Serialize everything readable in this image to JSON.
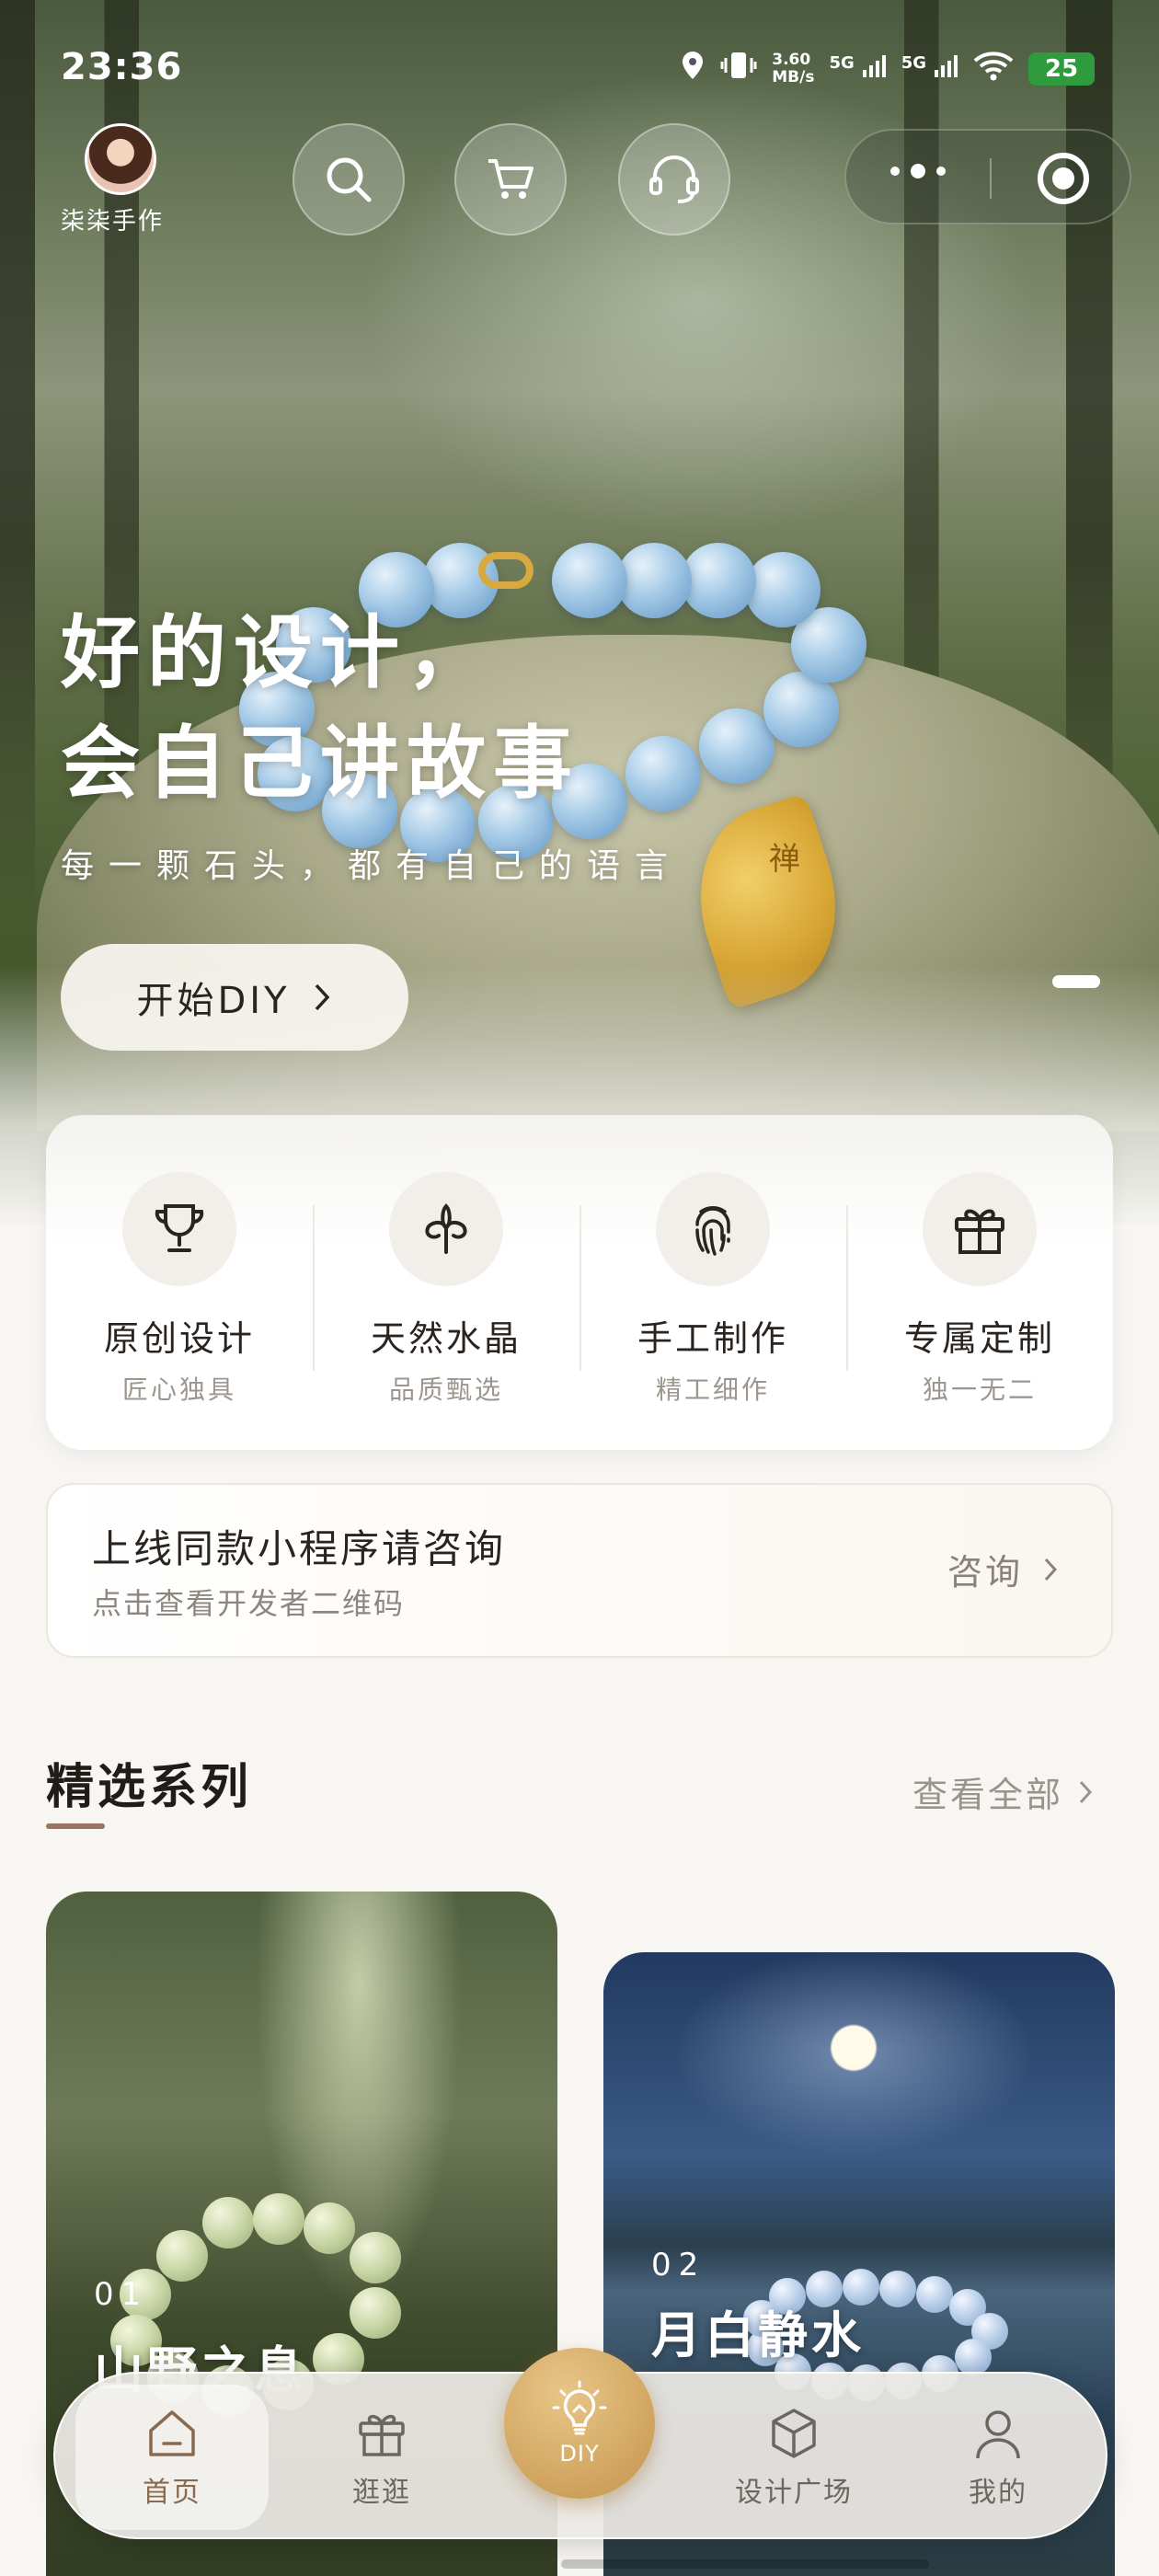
{
  "status_bar": {
    "time": "23:36",
    "net_speed_value": "3.60",
    "net_speed_unit": "MB/s",
    "signal_1": "5G",
    "signal_2": "5G",
    "battery": "25"
  },
  "header": {
    "shop_name": "柒柒手作",
    "icons": [
      "search-icon",
      "cart-icon",
      "headset-icon",
      "more-icon",
      "record-icon"
    ]
  },
  "hero": {
    "title_line1": "好的设计，",
    "title_line2": "会自己讲故事",
    "subtitle": "每一颗石头，都有自己的语言",
    "cta_label": "开始DIY",
    "pendant_char": "禅"
  },
  "features": [
    {
      "icon": "trophy-icon",
      "title": "原创设计",
      "subtitle": "匠心独具"
    },
    {
      "icon": "tree-icon",
      "title": "天然水晶",
      "subtitle": "品质甄选"
    },
    {
      "icon": "fingerprint-icon",
      "title": "手工制作",
      "subtitle": "精工细作"
    },
    {
      "icon": "gift-icon",
      "title": "专属定制",
      "subtitle": "独一无二"
    }
  ],
  "consult": {
    "title": "上线同款小程序请咨询",
    "subtitle": "点击查看开发者二维码",
    "button": "咨询"
  },
  "section": {
    "title": "精选系列",
    "view_all": "查看全部"
  },
  "series": [
    {
      "number": "01",
      "name": "山野之息"
    },
    {
      "number": "02",
      "name": "月白静水"
    }
  ],
  "tabbar": {
    "home": "首页",
    "browse": "逛逛",
    "diy": "DIY",
    "plaza": "设计广场",
    "mine": "我的",
    "active": "home"
  },
  "colors": {
    "accent_gold": "#d3a863",
    "active_tab_text": "#8a6a4e",
    "section_underline": "#9a7560",
    "battery": "#2e9b3c"
  }
}
